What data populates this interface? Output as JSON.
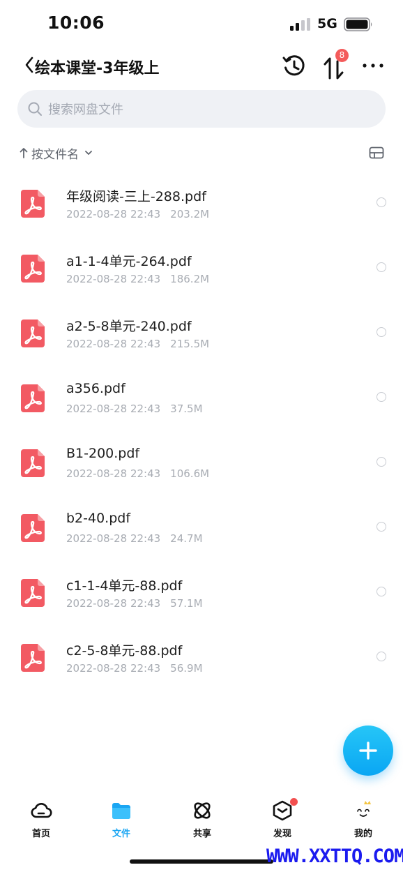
{
  "status_bar": {
    "time": "10:06",
    "network": "5G",
    "icons": [
      "signal-icon",
      "battery-icon"
    ]
  },
  "nav": {
    "title": "绘本课堂-3年级上",
    "transfer_badge": "8",
    "icons": [
      "back-icon",
      "history-icon",
      "transfer-icon",
      "more-icon"
    ]
  },
  "search": {
    "placeholder": "搜索网盘文件"
  },
  "sort": {
    "label": "按文件名"
  },
  "files": [
    {
      "name": "年级阅读-三上-288.pdf",
      "date": "2022-08-28 22:43",
      "size": "203.2M"
    },
    {
      "name": "a1-1-4单元-264.pdf",
      "date": "2022-08-28 22:43",
      "size": "186.2M"
    },
    {
      "name": "a2-5-8单元-240.pdf",
      "date": "2022-08-28 22:43",
      "size": "215.5M"
    },
    {
      "name": "a356.pdf",
      "date": "2022-08-28 22:43",
      "size": "37.5M"
    },
    {
      "name": "B1-200.pdf",
      "date": "2022-08-28 22:43",
      "size": "106.6M"
    },
    {
      "name": "b2-40.pdf",
      "date": "2022-08-28 22:43",
      "size": "24.7M"
    },
    {
      "name": "c1-1-4单元-88.pdf",
      "date": "2022-08-28 22:43",
      "size": "57.1M"
    },
    {
      "name": "c2-5-8单元-88.pdf",
      "date": "2022-08-28 22:43",
      "size": "56.9M"
    }
  ],
  "tabs": [
    {
      "label": "首页",
      "icon": "cloud-icon"
    },
    {
      "label": "文件",
      "icon": "folder-icon"
    },
    {
      "label": "共享",
      "icon": "share-atom-icon"
    },
    {
      "label": "发现",
      "icon": "discover-cube-icon"
    },
    {
      "label": "我的",
      "icon": "profile-icon"
    }
  ],
  "watermark": "WWW.XXTTQ.COM",
  "colors": {
    "accent": "#1ba6f3",
    "pdf": "#f25a63",
    "badge": "#f45b5b",
    "muted": "#a8acb3",
    "search_bg": "#eff1f5"
  }
}
